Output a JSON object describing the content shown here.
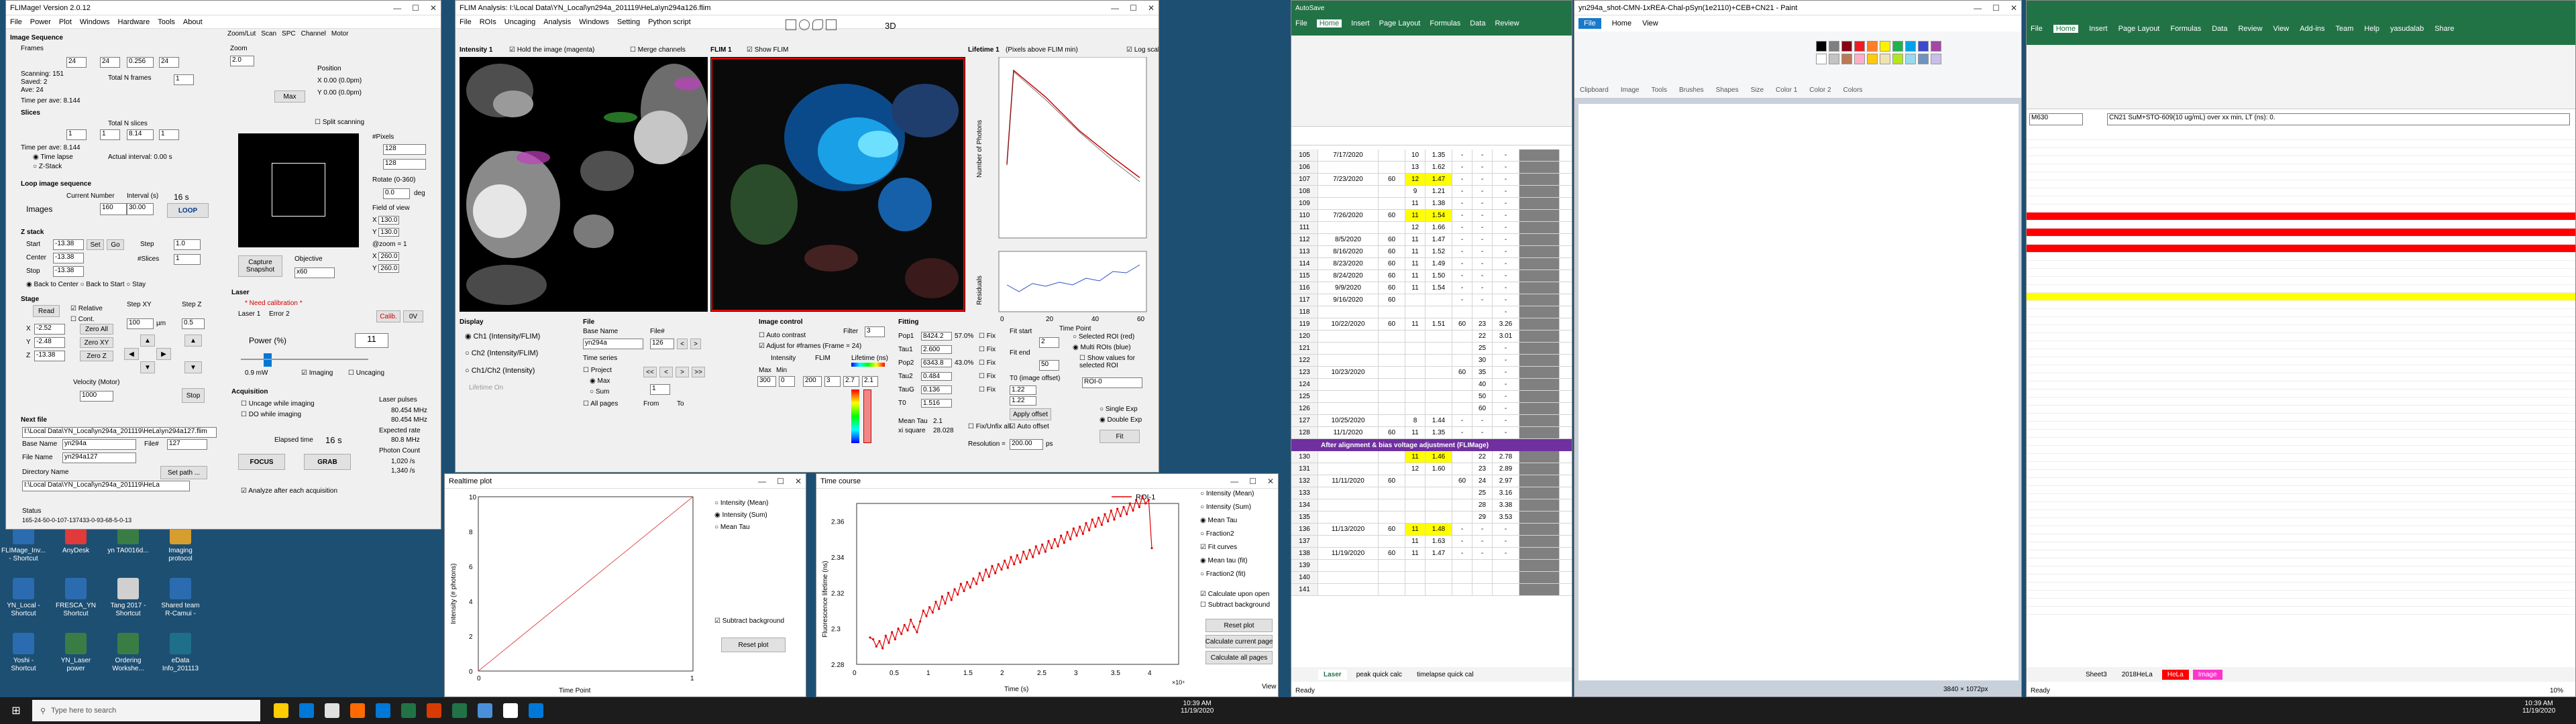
{
  "flimage": {
    "title": "FLIMage! Version 2.0.12",
    "menu": [
      "File",
      "Power",
      "Plot",
      "Windows",
      "Hardware",
      "Tools",
      "About"
    ],
    "image_seq": {
      "header": "Image Sequence",
      "frames_label": "Frames",
      "current": "24",
      "nframes": "24",
      "interval": "0.256",
      "average": "24",
      "scanning": "151",
      "saved": "2",
      "ave": "24",
      "total_frames": "Total N frames",
      "frames_val": "1",
      "time_per_ave": "Time per ave: 8.144"
    },
    "slices": {
      "header": "Slices",
      "current": "1",
      "nslices": "1",
      "interval": "8.14",
      "average": "1",
      "time_per_ave": "Time per ave: 8.144",
      "actual_interval": "Actual interval: 0.00 s",
      "time_lapse": "Time lapse",
      "zstack": "Z-Stack",
      "total_slices": "Total N slices"
    },
    "loop": {
      "header": "Loop image sequence",
      "current_number": "Current Number",
      "interval": "Interval (s)",
      "interval_val": "16 s",
      "images_label": "Images",
      "images_cur": "160",
      "images_total": "30.00",
      "loop_btn": "LOOP"
    },
    "zstack": {
      "header": "Z stack",
      "start": "-13.38",
      "end": "-13.38",
      "center": "-13.38",
      "step_label": "Step",
      "step": "1.0",
      "nslices": "#Slices",
      "nslices_val": "1",
      "set": "Set",
      "go": "Go",
      "back_center": "Back to Center",
      "back_start": "Back to Start",
      "stay": "Stay"
    },
    "stage": {
      "header": "Stage",
      "read": "Read",
      "relative": "Relative",
      "cont": "Cont.",
      "x": "-2.52",
      "y": "-2.48",
      "z": "-13.38",
      "step_xy": "Step XY",
      "step_xy_val": "100",
      "step_z": "Step Z",
      "step_z_val": "0.5",
      "unit": "µm",
      "zero_all": "Zero All",
      "zero_z": "Zero Z",
      "zero_xy": "Zero XY",
      "velocity": "Velocity (Motor)",
      "velocity_val": "1000",
      "stop": "Stop"
    },
    "zoom": {
      "header": "Zoom/Lut",
      "tabs": [
        "Zoom/Lut",
        "Scan",
        "SPC",
        "Channel",
        "Motor"
      ],
      "zoom_label": "Zoom",
      "zoom_val": "2.0",
      "max": "Max",
      "position": "Position",
      "pos_x": "0.00 (0.0pm)",
      "pos_y": "0.00 (0.0pm)",
      "split": "Split scanning",
      "xpixels": "#Pixels",
      "xp": "128",
      "yp": "128",
      "rotate": "Rotate (0-360)",
      "rotate_val": "0.0",
      "deg": "deg",
      "fov": "Field of view",
      "fov_x": "130.0",
      "fov_y": "130.0",
      "zoom_eq": "@zoom = 1",
      "fov_x1": "260.0",
      "fov_y1": "260.0",
      "capture": "Capture Snapshot",
      "objective": "Objective",
      "obj_val": "x60"
    },
    "laser": {
      "header": "Laser",
      "need_cal": "* Need calibration *",
      "laser1": "Laser 1",
      "error": "Error 2",
      "calib": "Calib.",
      "zero_v": "0V",
      "power_label": "Power (%)",
      "power_val": "11",
      "mw": "0.9 mW",
      "imaging": "Imaging",
      "uncaging": "Uncaging"
    },
    "acq": {
      "header": "Acquisition",
      "uncage_imaging": "Uncage while imaging",
      "do_while": "DO while imaging",
      "elapsed_label": "Elapsed time",
      "elapsed": "16 s",
      "focus": "FOCUS",
      "grab": "GRAB",
      "laser_pulses": "Laser pulses",
      "lp1": "80.454 MHz",
      "lp2": "80.454 MHz",
      "expected": "Expected rate",
      "exp_val": "80.8 MHz",
      "photon_count": "Photon Count",
      "pc1": "1,020 /s",
      "pc2": "1,340 /s",
      "analyze": "Analyze after each acquisition"
    },
    "nextfile": {
      "header": "Next file",
      "path": "I:\\Local Data\\YN_Local\\yn294a_201119\\HeLa\\yn294a127.flim",
      "base_label": "Base Name",
      "base": "yn294a",
      "file_label": "File#",
      "file_num": "127",
      "filename_label": "File Name",
      "filename": "yn294a127",
      "dir_label": "Directory Name",
      "dir": "I:\\Local Data\\YN_Local\\yn294a_201119\\HeLa",
      "setpath": "Set path ...",
      "status": "Status",
      "status_text": "165-24-50-0-107-137433-0-93-68-5-0-13"
    }
  },
  "flim_analysis": {
    "title": "FLIM Analysis: I:\\Local Data\\YN_Local\\yn294a_201119\\HeLa\\yn294a126.flim",
    "menu": [
      "File",
      "ROIs",
      "Uncaging",
      "Analysis",
      "Windows",
      "Setting",
      "Python script"
    ],
    "three_d": "3D",
    "hold_image": "Hold the image (magenta)",
    "merge": "Merge channels",
    "show_flim": "Show FLIM",
    "log_scale": "Log scale",
    "intensity_label": "Intensity 1",
    "flim_label": "FLIM 1",
    "lifetime_label": "Lifetime 1",
    "pixels_above": "(Pixels above FLIM min)",
    "lt_ylabel": "Number of Photons",
    "lt_y2label": "Residuals",
    "lt_xlabel": "Time Point",
    "lt_xticks": [
      "0",
      "20",
      "40",
      "60"
    ],
    "display": {
      "header": "Display",
      "ch1": "Ch1 (Intensity/FLIM)",
      "ch2": "Ch2 (Intensity/FLIM)",
      "ch12": "Ch1/Ch2 (Intensity)",
      "lifetime_on": "Lifetime On"
    },
    "file": {
      "header": "File",
      "base_label": "Base Name",
      "base": "yn294a",
      "file_label": "File#",
      "file": "126",
      "time_series": "Time series",
      "project": "Project",
      "max": "Max",
      "sum": "Sum",
      "all_pages": "All pages",
      "nav": [
        "<<",
        "<",
        ">",
        ">>"
      ],
      "from": "From",
      "to": "To",
      "page_val": "1",
      "page_of": "1"
    },
    "image_control": {
      "header": "Image control",
      "filter": "Filter",
      "filter_val": "3",
      "auto_contrast": "Auto contrast",
      "adjust": "Adjust for #frames (Frame = 24)",
      "intensity": "Intensity",
      "flim": "FLIM",
      "lifetime_ns": "Lifetime (ns)",
      "max_label": "Max",
      "min_label": "Min",
      "imax": "300",
      "imin": "0",
      "fmax": "200",
      "fmin": "3",
      "lt_max": "2.7",
      "lt_min": "2.1"
    },
    "fitting": {
      "header": "Fitting",
      "pop1": "8424.2",
      "pop1p": "57.0%",
      "tau1": "2.600",
      "pop2": "6343.8",
      "pop2p": "43.0%",
      "tau2": "0.484",
      "taug": "0.136",
      "t0": "1.516",
      "mean_tau": "2.1",
      "xsq": "28.028",
      "fix_labels": [
        "Fix",
        "Fix",
        "Fix",
        "Fix",
        "Fix"
      ],
      "fitstart_label": "Fit start",
      "fitstart": "2",
      "fitend_label": "Fit end",
      "fitend": "50",
      "t0_label": "T0 (image offset)",
      "t0_off": "1.22",
      "t0_2": "1.22",
      "apply_offset": "Apply offset",
      "auto_offset": "Auto offset",
      "fit_labels": [
        "Pop1",
        "Tau1",
        "Pop2",
        "Tau2",
        "TauG",
        "T0"
      ],
      "mean_tau_label": "Mean Tau",
      "xsq_label": "xi square",
      "fixinfo": "Fix/Unfix all",
      "resolution": "Resolution =",
      "res_val": "200.00",
      "ps": "ps",
      "selected_roi": "Selected ROI (red)",
      "multi_roi": "Multi ROIs (blue)",
      "show_values": "Show values for selected ROI",
      "roi_sel": "ROI-0",
      "single": "Single Exp",
      "double": "Double Exp",
      "fit": "Fit"
    }
  },
  "realtime": {
    "title": "Realtime plot",
    "ylabel": "Intensity (# photons)",
    "xlabel": "Time Point",
    "yticks": [
      "0",
      "2",
      "4",
      "6",
      "8",
      "10"
    ],
    "xticks": [
      "0",
      "1"
    ],
    "opts": [
      "Intensity (Mean)",
      "Intensity (Sum)",
      "Mean Tau"
    ],
    "subtract": "Subtract background",
    "reset": "Reset plot"
  },
  "timecourse": {
    "title": "Time course",
    "legend": "ROI-1",
    "ylabel": "Fluorescence lifetime (ns)",
    "xlabel": "Time (s)",
    "yticks": [
      "2.28",
      "2.3",
      "2.32",
      "2.34",
      "2.36"
    ],
    "xticks": [
      "0",
      "0.5",
      "1",
      "1.5",
      "2",
      "2.5",
      "3",
      "3.5",
      "4"
    ],
    "xexp": "×10⁴",
    "opts": [
      "Intensity (Mean)",
      "Intensity (Sum)",
      "Mean Tau",
      "Fraction2",
      "Fit curves",
      "Mean tau (fit)",
      "Fraction2 (fit)"
    ],
    "calc_upon": "Calculate upon open",
    "subtract": "Subtract background",
    "reset": "Reset plot",
    "calc_current": "Calculate current page",
    "calc_all": "Calculate all pages",
    "view": "View",
    "series": [
      2.295,
      2.294,
      2.29,
      2.293,
      2.289,
      2.296,
      2.292,
      2.298,
      2.294,
      2.3,
      2.297,
      2.302,
      2.299,
      2.305,
      2.301,
      2.298,
      2.304,
      2.31,
      2.307,
      2.312,
      2.309,
      2.315,
      2.311,
      2.318,
      2.314,
      2.32,
      2.316,
      2.322,
      2.319,
      2.325,
      2.321,
      2.326,
      2.323,
      2.328,
      2.325,
      2.331,
      2.327,
      2.333,
      2.329,
      2.335,
      2.331,
      2.336,
      2.333,
      2.338,
      2.334,
      2.34,
      2.336,
      2.341,
      2.337,
      2.343,
      2.339,
      2.344,
      2.34,
      2.346,
      2.342,
      2.347,
      2.343,
      2.349,
      2.345,
      2.35,
      2.346,
      2.352,
      2.348,
      2.354,
      2.35,
      2.356,
      2.352,
      2.357,
      2.353,
      2.359,
      2.355,
      2.361,
      2.357,
      2.362,
      2.358,
      2.364,
      2.36,
      2.366,
      2.361,
      2.367,
      2.363,
      2.368,
      2.364,
      2.37,
      2.366,
      2.372,
      2.368,
      2.374,
      2.37,
      2.372,
      2.345
    ]
  },
  "excel1": {
    "title": "AutoSave",
    "tabs": [
      "File",
      "Home",
      "Insert",
      "Page Layout",
      "Formulas",
      "Data",
      "Review"
    ],
    "sheet_tabs": [
      "Laser",
      "peak quick calc",
      "timelapse quick cal"
    ],
    "status": "Ready",
    "rows": [
      [
        "105",
        "7/17/2020",
        "",
        "10",
        "1.35",
        "-",
        "-",
        "-"
      ],
      [
        "106",
        "",
        "",
        "13",
        "1.62",
        "-",
        "-",
        "-"
      ],
      [
        "107",
        "7/23/2020",
        "60",
        "12",
        "1.47",
        "-",
        "-",
        "-"
      ],
      [
        "108",
        "",
        "",
        "9",
        "1.21",
        "-",
        "-",
        "-"
      ],
      [
        "109",
        "",
        "",
        "11",
        "1.38",
        "-",
        "-",
        "-"
      ],
      [
        "110",
        "7/26/2020",
        "60",
        "11",
        "1.54",
        "-",
        "-",
        "-"
      ],
      [
        "111",
        "",
        "",
        "12",
        "1.66",
        "-",
        "-",
        "-"
      ],
      [
        "112",
        "8/5/2020",
        "60",
        "11",
        "1.47",
        "-",
        "-",
        "-"
      ],
      [
        "113",
        "8/16/2020",
        "60",
        "11",
        "1.52",
        "-",
        "-",
        "-"
      ],
      [
        "114",
        "8/23/2020",
        "60",
        "11",
        "1.49",
        "-",
        "-",
        "-"
      ],
      [
        "115",
        "8/24/2020",
        "60",
        "11",
        "1.50",
        "-",
        "-",
        "-"
      ],
      [
        "116",
        "9/9/2020",
        "60",
        "11",
        "1.54",
        "-",
        "-",
        "-"
      ],
      [
        "117",
        "9/16/2020",
        "60",
        "",
        "",
        "-",
        "-",
        "-"
      ],
      [
        "118",
        "",
        "",
        "",
        "",
        "",
        "",
        "-"
      ],
      [
        "119",
        "10/22/2020",
        "60",
        "11",
        "1.51",
        "60",
        "23",
        "3.26"
      ],
      [
        "120",
        "",
        "",
        "",
        "",
        "",
        "22",
        "3.01"
      ],
      [
        "121",
        "",
        "",
        "",
        "",
        "",
        "25",
        "-"
      ],
      [
        "122",
        "",
        "",
        "",
        "",
        "",
        "30",
        "-"
      ],
      [
        "123",
        "10/23/2020",
        "",
        "",
        "",
        "60",
        "35",
        "-"
      ],
      [
        "124",
        "",
        "",
        "",
        "",
        "",
        "40",
        "-"
      ],
      [
        "125",
        "",
        "",
        "",
        "",
        "",
        "50",
        "-"
      ],
      [
        "126",
        "",
        "",
        "",
        "",
        "",
        "60",
        "-"
      ],
      [
        "127",
        "10/25/2020",
        "",
        "8",
        "1.44",
        "-",
        "-",
        "-"
      ],
      [
        "128",
        "11/1/2020",
        "60",
        "11",
        "1.35",
        "-",
        "-",
        "-"
      ]
    ],
    "banner": "After alignment & bias voltage adjustment (FLIMage)",
    "rows2": [
      [
        "130",
        "",
        "",
        "11",
        "1.46",
        "",
        "22",
        "2.78"
      ],
      [
        "131",
        "",
        "",
        "12",
        "1.60",
        "",
        "23",
        "2.89"
      ],
      [
        "132",
        "11/11/2020",
        "60",
        "",
        "",
        "60",
        "24",
        "2.97"
      ],
      [
        "133",
        "",
        "",
        "",
        "",
        "",
        "25",
        "3.16"
      ],
      [
        "134",
        "",
        "",
        "",
        "",
        "",
        "28",
        "3.38"
      ],
      [
        "135",
        "",
        "",
        "",
        "",
        "",
        "29",
        "3.53"
      ],
      [
        "136",
        "11/13/2020",
        "60",
        "11",
        "1.48",
        "-",
        "-",
        "-"
      ],
      [
        "137",
        "",
        "",
        "11",
        "1.63",
        "-",
        "-",
        "-"
      ],
      [
        "138",
        "11/19/2020",
        "60",
        "11",
        "1.47",
        "-",
        "-",
        "-"
      ],
      [
        "139",
        "",
        "",
        "",
        "",
        "",
        "",
        ""
      ],
      [
        "140",
        "",
        "",
        "",
        "",
        "",
        "",
        ""
      ],
      [
        "141",
        "",
        "",
        "",
        "",
        "",
        "",
        ""
      ]
    ]
  },
  "paint": {
    "title": "yn294a_shot-CMN-1xREA-Chal-pSyn(1e2110)+CEB+CN21 - Paint",
    "tabs": [
      "File",
      "Home",
      "View"
    ],
    "groups": [
      "Clipboard",
      "Image",
      "Tools",
      "Brushes",
      "Shapes",
      "Size",
      "Color 1",
      "Color 2",
      "Colors"
    ],
    "status": "3840 × 1072px"
  },
  "excel2": {
    "tabs": [
      "File",
      "Home",
      "Insert",
      "Page Layout",
      "Formulas",
      "Data",
      "Review",
      "View",
      "Add-ins",
      "Team",
      "Help",
      "yasudalab",
      "Share"
    ],
    "namebox": "M630",
    "formula": "CN21 SuM+STO-609(10 ug/mL) over xx min, LT (ns): 0.",
    "sheet_tabs": [
      "Sheet3",
      "2018HeLa",
      "HeLa",
      "Image"
    ],
    "status": "Ready",
    "zoom": "10%"
  },
  "desktop": {
    "icons": [
      [
        "FLIMage_Inv... - Shortcut",
        ""
      ],
      [
        "AnyDesk",
        ""
      ],
      [
        "yn TA0016d...",
        ""
      ],
      [
        "Imaging protocol",
        ""
      ],
      [
        "YN_Local - Shortcut",
        ""
      ],
      [
        "FRESCA_YN Shortcut",
        ""
      ],
      [
        "Tang 2017 - Shortcut",
        ""
      ],
      [
        "Shared team R-Camui -",
        ""
      ],
      [
        "Yoshi - Shortcut",
        ""
      ],
      [
        "YN_Laser power",
        ""
      ],
      [
        "Ordering Workshe...",
        ""
      ],
      [
        "eData Info_201113",
        ""
      ]
    ]
  },
  "taskbar": {
    "search": "Type here to search",
    "time": "10:39 AM",
    "date": "11/19/2020",
    "time2": "10:39 AM",
    "date2": "11/19/2020"
  },
  "colors": {
    "excel_green": "#217346",
    "flim_blue": "#0078d7",
    "tc_red": "#e00000"
  }
}
